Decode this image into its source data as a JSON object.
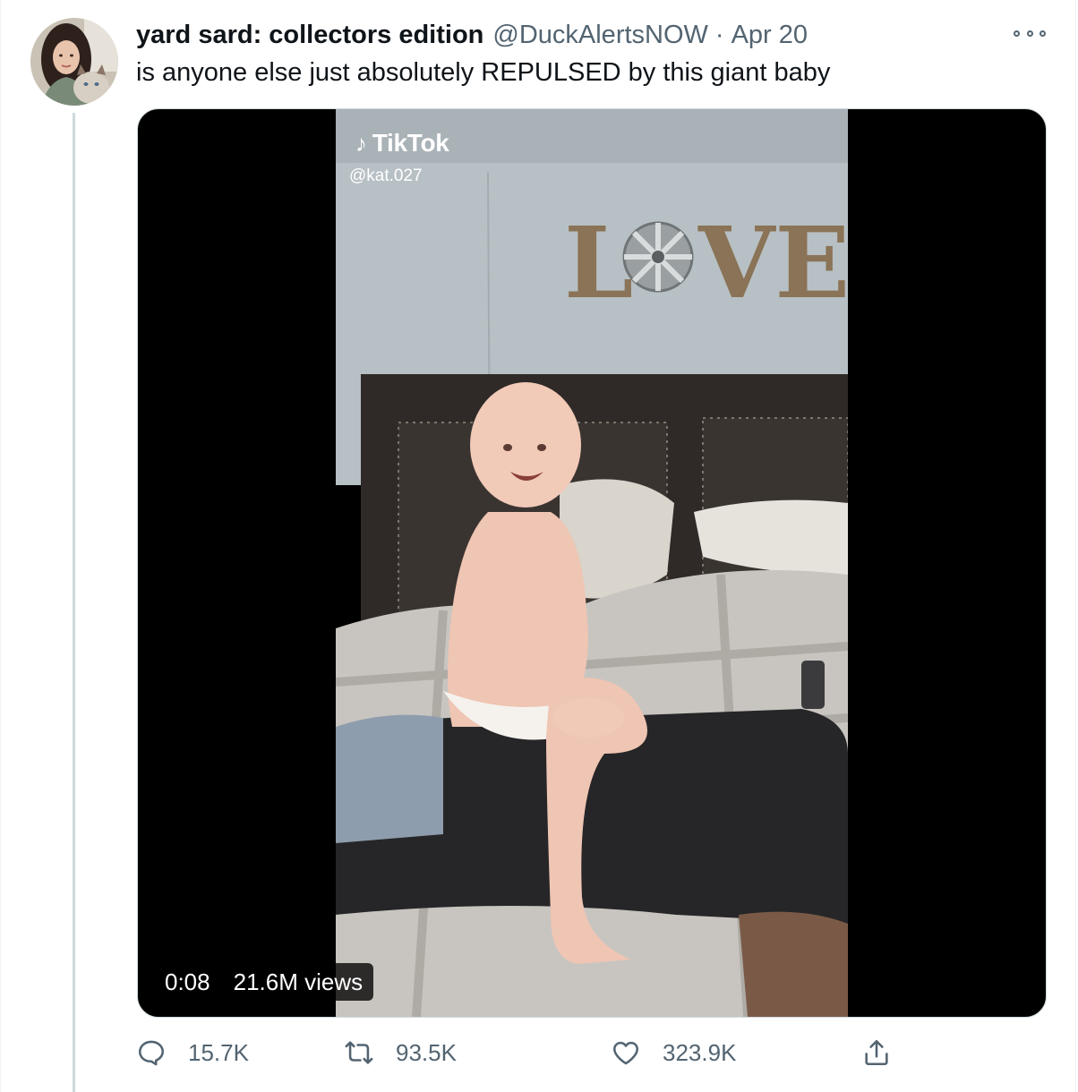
{
  "tweet": {
    "display_name": "yard sard: collectors edition",
    "handle": "@DuckAlertsNOW",
    "separator": "·",
    "date": "Apr 20",
    "text": "is anyone else just absolutely REPULSED by this giant baby"
  },
  "media": {
    "watermark_brand": "TikTok",
    "watermark_user": "@kat.027",
    "wall_lettering": "LOVE",
    "duration": "0:08",
    "views": "21.6M views"
  },
  "actions": {
    "replies": "15.7K",
    "retweets": "93.5K",
    "likes": "323.9K"
  },
  "icons": {
    "more": "more-horizontal-icon",
    "reply": "reply-icon",
    "retweet": "retweet-icon",
    "like": "heart-icon",
    "share": "share-icon"
  },
  "colors": {
    "text": "#0f1419",
    "secondary": "#536471",
    "border": "#cfd9de"
  }
}
